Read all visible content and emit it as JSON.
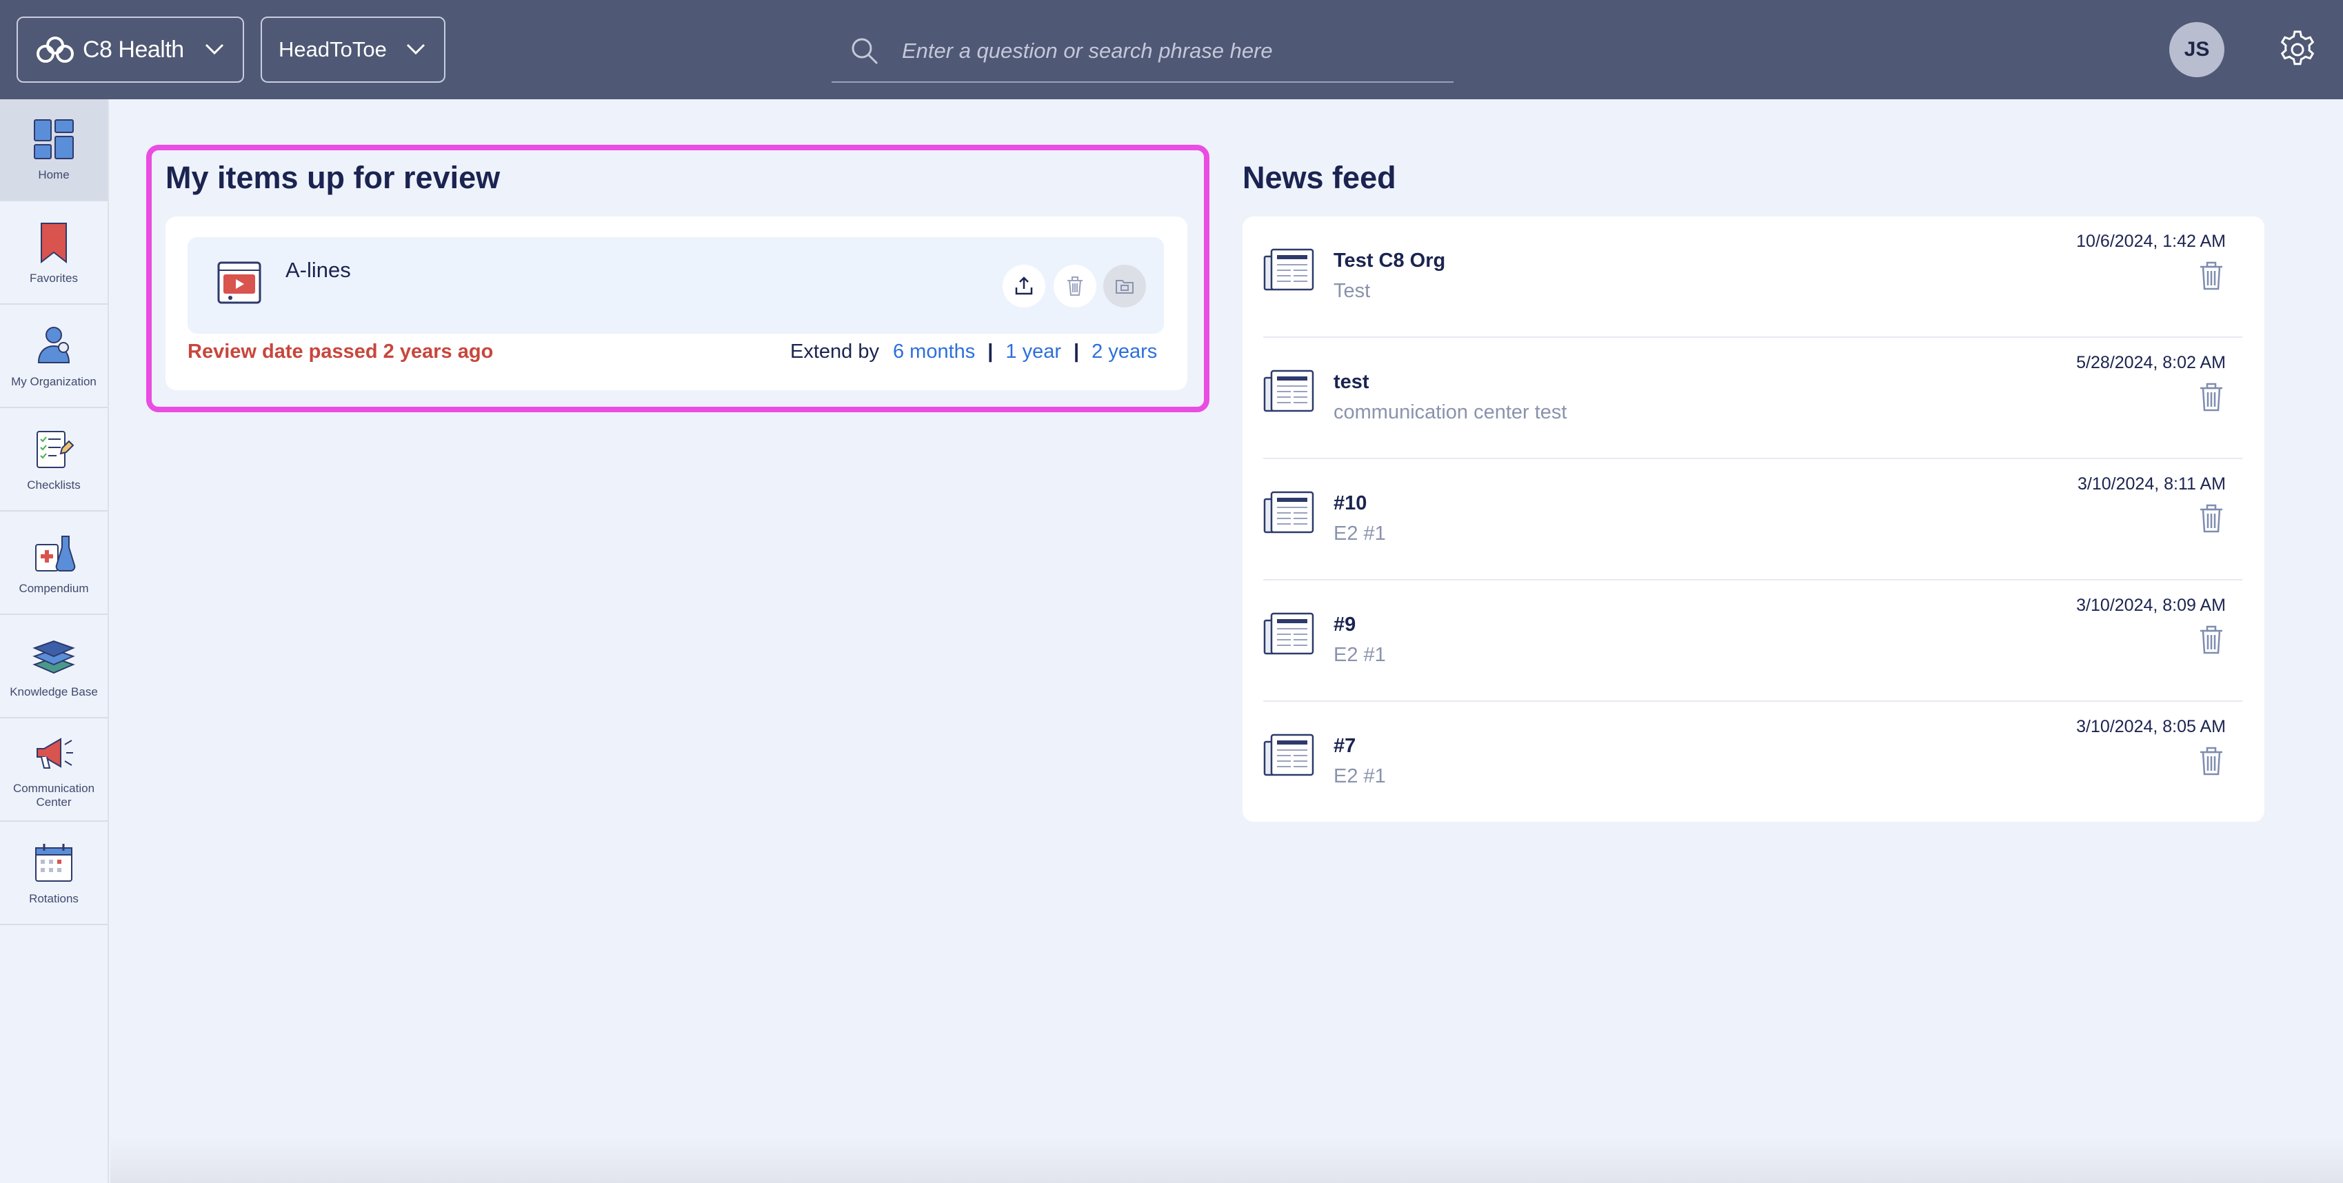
{
  "header": {
    "org_name": "C8 Health",
    "department": "HeadToToe",
    "search_placeholder": "Enter a question or search phrase here",
    "user_initials": "JS"
  },
  "sidebar": {
    "items": [
      {
        "label": "Home",
        "icon": "home-grid-icon",
        "active": true
      },
      {
        "label": "Favorites",
        "icon": "bookmark-icon",
        "active": false
      },
      {
        "label": "My Organization",
        "icon": "people-icon",
        "active": false
      },
      {
        "label": "Checklists",
        "icon": "checklist-icon",
        "active": false
      },
      {
        "label": "Compendium",
        "icon": "medical-flask-icon",
        "active": false
      },
      {
        "label": "Knowledge Base",
        "icon": "books-icon",
        "active": false
      },
      {
        "label": "Communication Center",
        "icon": "megaphone-icon",
        "active": false
      },
      {
        "label": "Rotations",
        "icon": "calendar-icon",
        "active": false
      }
    ]
  },
  "review": {
    "title": "My items up for review",
    "item_name": "A-lines",
    "warning": "Review date passed 2 years ago",
    "extend_label": "Extend by",
    "extend_options": [
      "6 months",
      "1 year",
      "2 years"
    ],
    "separator": "|"
  },
  "news_feed": {
    "title": "News feed",
    "items": [
      {
        "title": "Test C8 Org",
        "subtitle": "Test",
        "date": "10/6/2024, 1:42 AM"
      },
      {
        "title": "test",
        "subtitle": "communication center test",
        "date": "5/28/2024, 8:02 AM"
      },
      {
        "title": "#10",
        "subtitle": "E2 #1",
        "date": "3/10/2024, 8:11 AM"
      },
      {
        "title": "#9",
        "subtitle": "E2 #1",
        "date": "3/10/2024, 8:09 AM"
      },
      {
        "title": "#7",
        "subtitle": "E2 #1",
        "date": "3/10/2024, 8:05 AM"
      }
    ]
  },
  "colors": {
    "topbar": "#4f5874",
    "background": "#eef2fb",
    "highlight_border": "#ea4de2",
    "warning": "#c8463c",
    "link": "#2d6fdc",
    "text": "#1b2450"
  }
}
